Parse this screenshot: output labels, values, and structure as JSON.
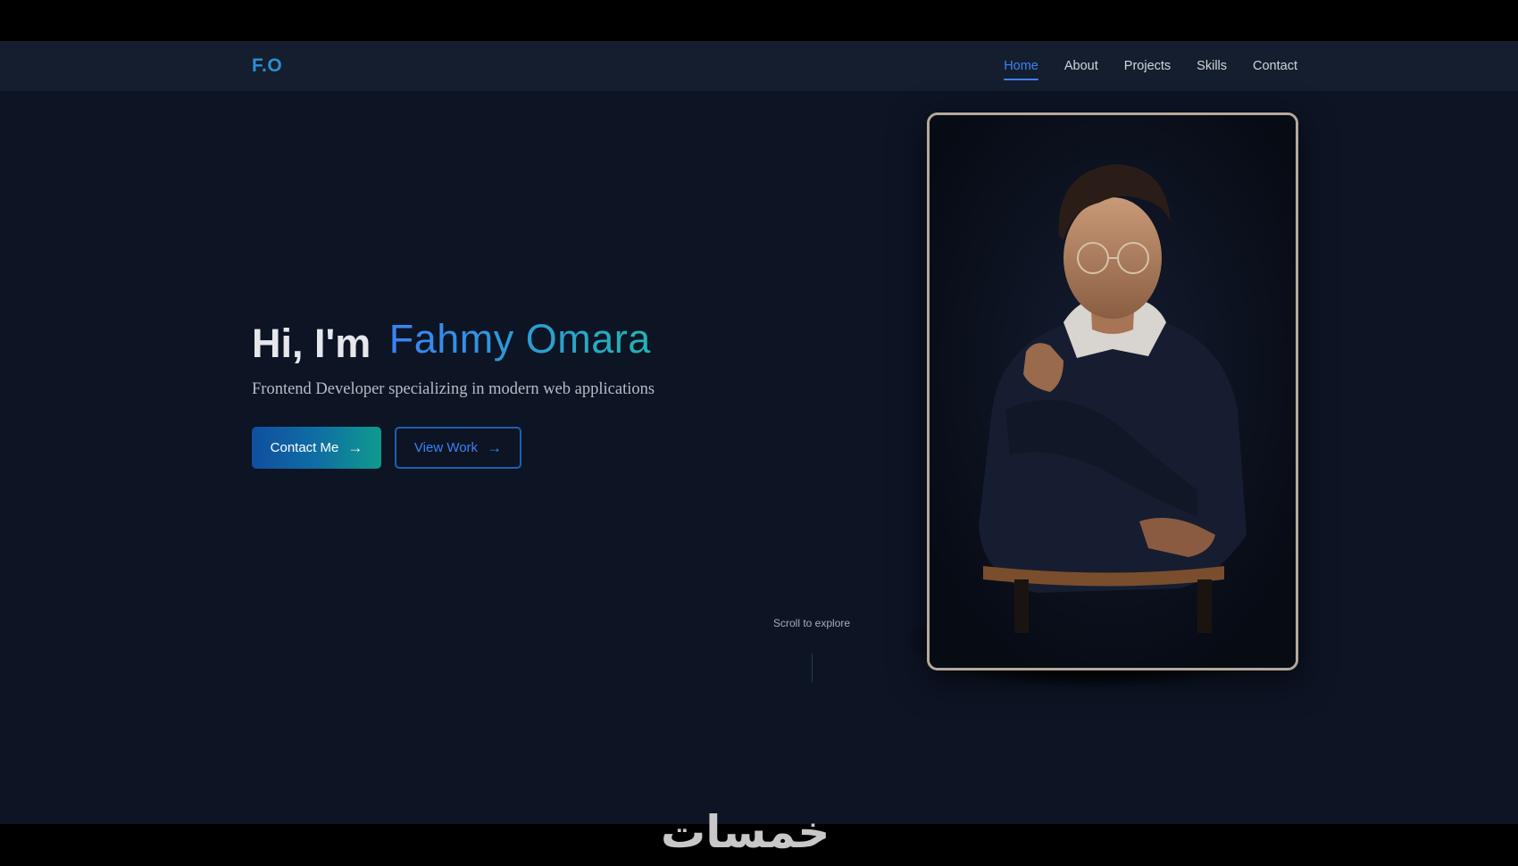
{
  "nav": {
    "logo": "F.O",
    "links": [
      {
        "label": "Home",
        "active": true
      },
      {
        "label": "About",
        "active": false
      },
      {
        "label": "Projects",
        "active": false
      },
      {
        "label": "Skills",
        "active": false
      },
      {
        "label": "Contact",
        "active": false
      }
    ]
  },
  "hero": {
    "greeting": "Hi, I'm",
    "name": "Fahmy Omara",
    "subtitle": "Frontend Developer specializing in modern web applications",
    "primary_button": "Contact Me",
    "secondary_button": "View Work",
    "scroll_hint": "Scroll to explore"
  },
  "photo": {
    "icon": "portrait-photo"
  },
  "watermark": "خمسات",
  "colors": {
    "accent": "#3b82f6",
    "accent_teal": "#22b3b3",
    "background": "#0d1424",
    "nav_background": "#151e2e"
  }
}
